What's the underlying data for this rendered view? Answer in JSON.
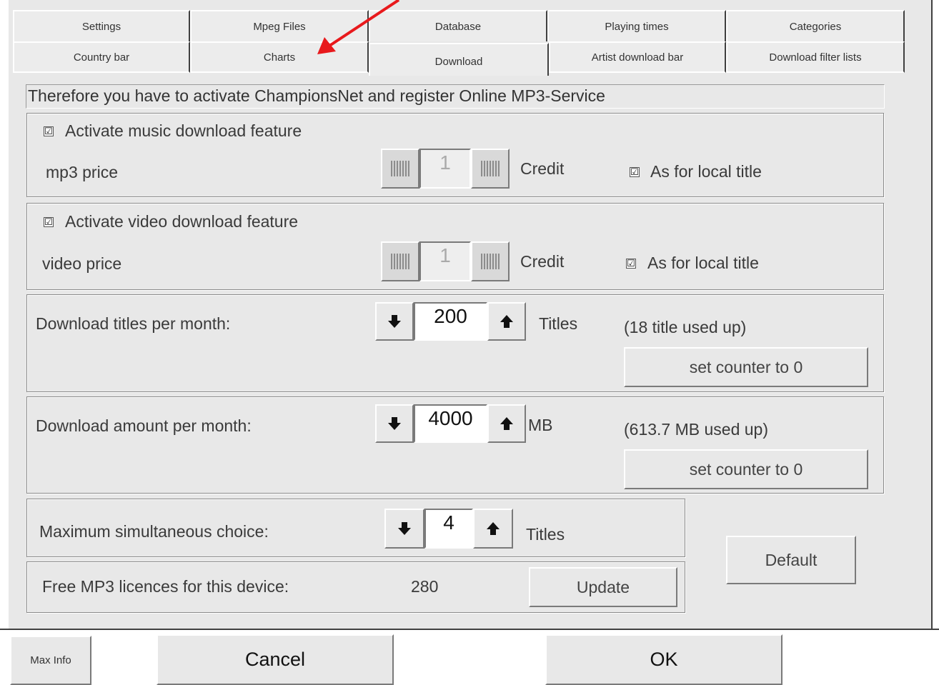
{
  "tabs_row1": [
    "Settings",
    "Mpeg Files",
    "Database",
    "Playing times",
    "Categories"
  ],
  "tabs_row2": [
    "Country bar",
    "Charts",
    "Download",
    "Artist download bar",
    "Download filter lists"
  ],
  "active_tab": "Download",
  "info_text": "Therefore you have to activate ChampionsNet and register Online MP3-Service",
  "music": {
    "activate_label": "Activate music download feature",
    "activate_checked": true,
    "price_label": "mp3 price",
    "price_value": "1",
    "unit": "Credit",
    "as_local_label": "As for local title",
    "as_local_checked": true
  },
  "video": {
    "activate_label": "Activate video download feature",
    "activate_checked": true,
    "price_label": "video price",
    "price_value": "1",
    "unit": "Credit",
    "as_local_label": "As for local title",
    "as_local_checked": true
  },
  "titles_per_month": {
    "label": "Download titles per month:",
    "value": "200",
    "unit": "Titles",
    "used": "(18 title used up)",
    "reset_label": "set counter to 0"
  },
  "amount_per_month": {
    "label": "Download amount per month:",
    "value": "4000",
    "unit": "MB",
    "used": "(613.7 MB used up)",
    "reset_label": "set counter to 0"
  },
  "max_choice": {
    "label": "Maximum simultaneous choice:",
    "value": "4",
    "unit": "Titles"
  },
  "licences": {
    "label": "Free MP3 licences for this device:",
    "value": "280",
    "update_label": "Update"
  },
  "default_label": "Default",
  "footer": {
    "max_info": "Max Info",
    "cancel": "Cancel",
    "ok": "OK"
  },
  "check_glyph": "☑",
  "colors": {
    "panel": "#e8e8e8",
    "annotation_arrow": "#e8191c"
  }
}
